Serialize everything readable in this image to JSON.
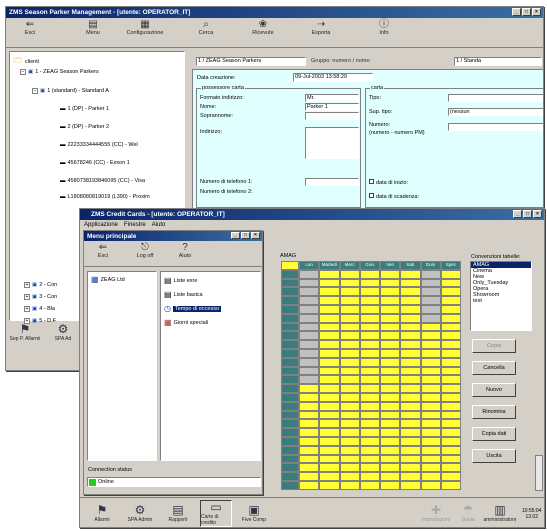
{
  "back_window": {
    "title": "ZMS Season Parker Management - [utente: OPERATOR_IT]",
    "toolbar": [
      "Esci",
      "Menu",
      "Configurazione",
      "Cerca",
      "Ricevute",
      "Esporta",
      "Info"
    ],
    "tree_root": "clienti",
    "tree_items": [
      "1 - ZEAG Season Parkers",
      "1 (standard) - Standard A",
      "1 (DP) - Parker 1",
      "2 (DP) - Parker 2",
      "22233334444555 (CC) - Wel",
      "45678246 (CC) - Exxon 1",
      "4580738193846095 (CC) - Visa",
      "L1808080819019 (L390) - Proxim"
    ],
    "tree_bottom_items": [
      "2 - Con",
      "3 - Con",
      "4 - Bla",
      "5 - D.F"
    ],
    "header_fields": {
      "path": "1 / ZEAG Season Parkers",
      "group_label": "Gruppo: numero / nome:",
      "group_value": "1 / Standa"
    },
    "form": {
      "creation_label": "Data creazione:",
      "creation_value": "09-Jul-2003 13:58:29",
      "owner_section": "possessore carta",
      "address_format_label": "Formato indirizzo:",
      "address_format_value": "Mr.",
      "name_label": "Nome:",
      "name_value": "Parker 1",
      "surname_label": "Soprannome:",
      "address_label": "Indirizzo:",
      "phone1_label": "Numero di telefono 1:",
      "phone2_label": "Numero di telefono 2:",
      "card_section": "carta",
      "type_label": "Tipo:",
      "sup_type_label": "Sup. tipo:",
      "sup_type_value": "(nessun",
      "number_label": "Numero:",
      "number_hint": "(numero - numero PM)",
      "start_date_label": "data di inizio:",
      "expiry_label": "data di scadenza:"
    },
    "bottom_buttons": [
      "Sep P. Allarmi",
      "SPA Ad"
    ]
  },
  "front_window": {
    "title": "ZMS Credit Cards - [utente: OPERATOR_IT]",
    "menu": [
      "Applicazione",
      "Finestre",
      "Aiuto"
    ],
    "inner_window": {
      "title": "Menu principale",
      "toolbar": [
        "Esci",
        "Log off",
        "Aiuto"
      ],
      "tree_item": "ZEAG Ltd",
      "list_items": [
        "Liste exre",
        "Liste basica",
        "Tempo di eccesso",
        "Giorni speciali"
      ],
      "connection_label": "Connection status",
      "connection_value": "Online"
    },
    "grid_title": "AMAG",
    "grid_header": [
      "Lun",
      "Martedì",
      "Merc",
      "Giov",
      "Ven",
      "Sab",
      "Dom",
      "Spec"
    ],
    "grid_rows": 25,
    "right_panel": {
      "label": "Convenzioni tabelle:",
      "options": [
        "AMAG",
        "Cinema",
        "New",
        "Only_Tuesday",
        "Opera",
        "Showroom",
        "test"
      ],
      "selected": "AMAG"
    },
    "action_buttons": [
      "Copia",
      "Cancella",
      "Nuovo",
      "Rinomina",
      "Copia dati",
      "Uscita"
    ]
  },
  "taskbar": {
    "left": [
      "Allarmi",
      "SPA Admin",
      "Rapporti",
      "Carte di credito",
      "Five Comp"
    ],
    "right": [
      "Impostazioni",
      "Guida",
      "amministratore"
    ],
    "clock": "10:55:04",
    "clock_sub": "13.02"
  },
  "colors": {
    "accent_title": "#0a246a",
    "grid_yellow": "#ffff33",
    "grid_gray": "#c0c0c0",
    "grid_teal": "#3c7c7c",
    "selection": "#0a246a",
    "online": "#22cc22"
  }
}
